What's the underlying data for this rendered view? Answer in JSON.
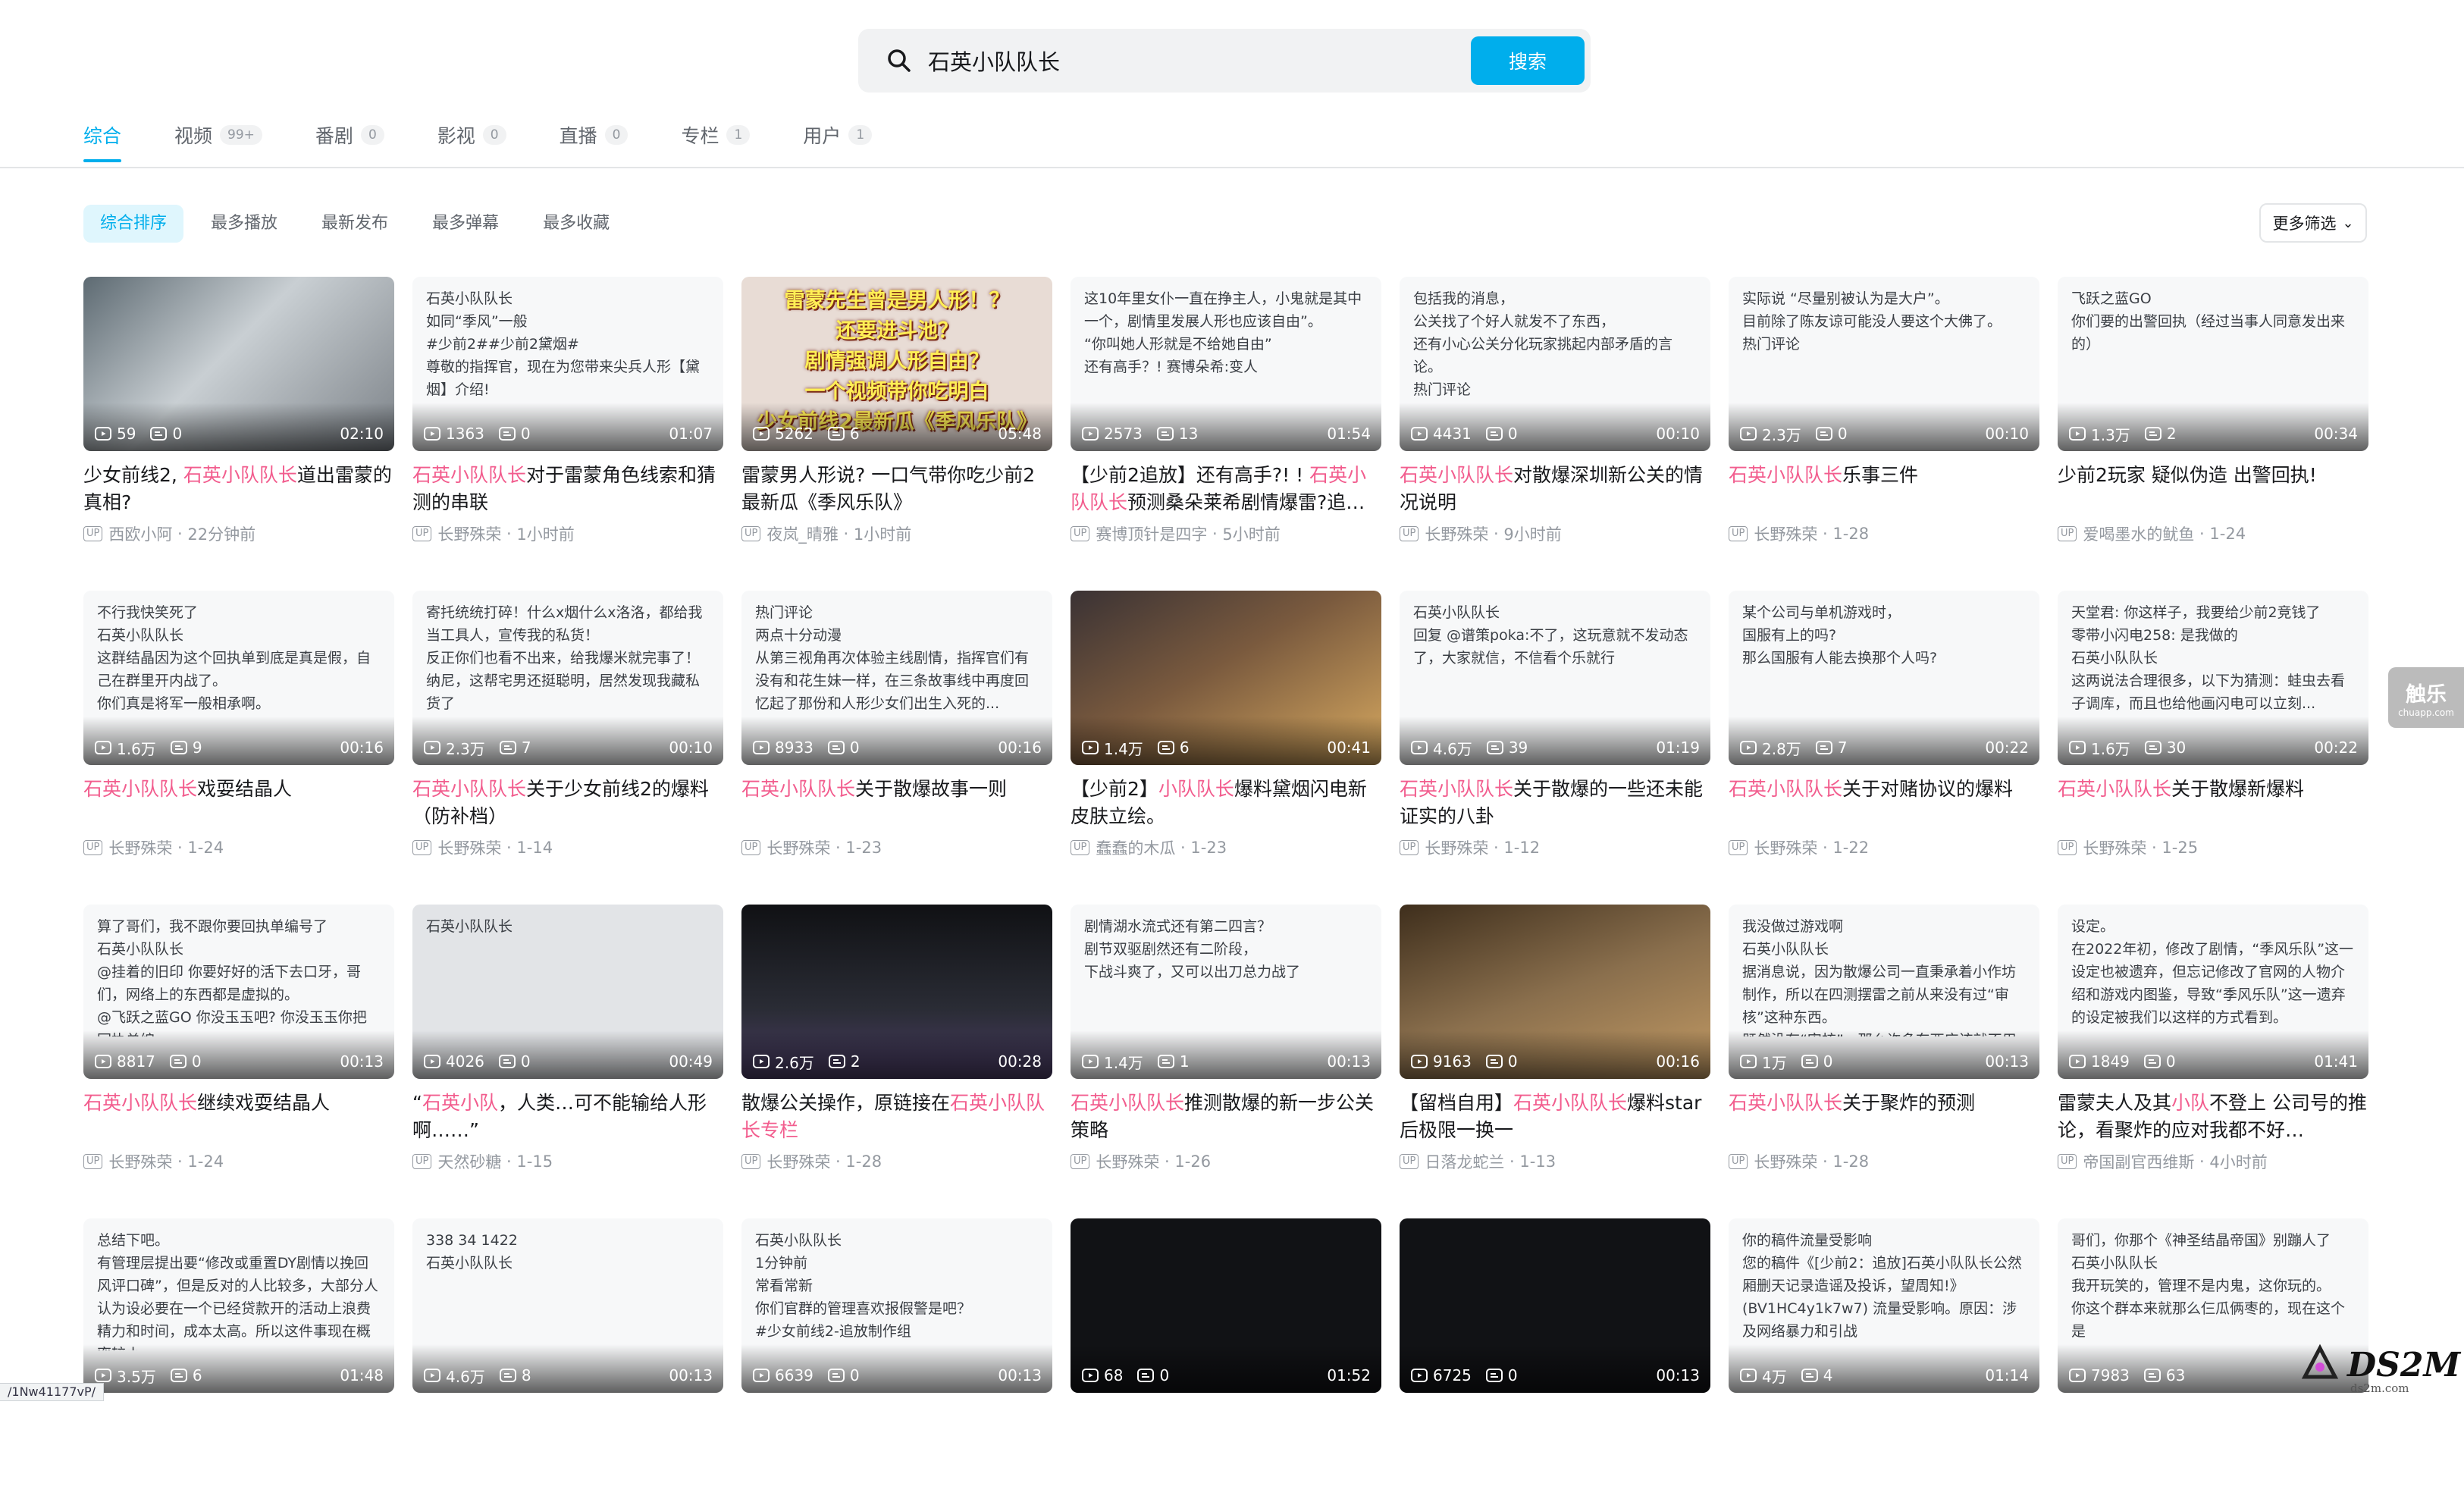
{
  "search": {
    "query": "石英小队队长",
    "button": "搜索"
  },
  "tabs": [
    {
      "label": "综合",
      "count": ""
    },
    {
      "label": "视频",
      "count": "99+"
    },
    {
      "label": "番剧",
      "count": "0"
    },
    {
      "label": "影视",
      "count": "0"
    },
    {
      "label": "直播",
      "count": "0"
    },
    {
      "label": "专栏",
      "count": "1"
    },
    {
      "label": "用户",
      "count": "1"
    }
  ],
  "sorts": [
    "综合排序",
    "最多播放",
    "最新发布",
    "最多弹幕",
    "最多收藏"
  ],
  "filter": {
    "label": "更多筛选"
  },
  "side_widget": {
    "big": "触乐",
    "small": "chuapp.com"
  },
  "brand": {
    "name": "DS2M",
    "sub": "ds2m.com"
  },
  "url_fragment": "/1Nw41177vP/",
  "colors": {
    "accent": "#00aeec",
    "highlight": "#f25d8e",
    "meta": "#9499a0"
  },
  "cards": [
    {
      "thumb": "t-photo1",
      "text": "",
      "banner": "",
      "plays": "59",
      "danmaku": "0",
      "duration": "02:10",
      "title_pre": "少女前线2, ",
      "title_hl": "石英小队队长",
      "title_post": "道出雷蒙的真相?",
      "author": "西欧小阿",
      "date": "22分钟前"
    },
    {
      "thumb": "t-white",
      "text": "石英小队队长\n如同“季风”一般\n#少前2##少前2黛烟#\n尊敬的指挥官，现在为您带来尖兵人形【黛烟】介绍!",
      "banner": "",
      "plays": "1363",
      "danmaku": "0",
      "duration": "01:07",
      "title_pre": "",
      "title_hl": "石英小队队长",
      "title_post": "对于雷蒙角色线索和猜测的串联",
      "author": "长野殊荣",
      "date": "1小时前"
    },
    {
      "thumb": "t-banner",
      "text": "",
      "banner": "雷蒙先生曾是男人形！？\n还要进斗池？\n剧情强调人形自由？\n一个视频带你吃明白\n少女前线2最新瓜《季风乐队》",
      "plays": "5262",
      "danmaku": "6",
      "duration": "05:48",
      "title_pre": "雷蒙男人形说? 一口气带你吃少前2最新瓜《季风乐队》",
      "title_hl": "",
      "title_post": "",
      "author": "夜岚_晴雅",
      "date": "1小时前"
    },
    {
      "thumb": "t-white",
      "text": "这10年里女仆一直在挣主人，小鬼就是其中一个，剧情里发展人形也应该自由”。\n“你叫她人形就是不给她自由”\n还有高手？! 赛博朵希:变人",
      "banner": "",
      "plays": "2573",
      "danmaku": "13",
      "duration": "01:54",
      "title_pre": "【少前2追放】还有高手?! ! ",
      "title_hl": "石英小队队长",
      "title_post": "预测桑朵莱希剧情爆雷?追放…",
      "author": "赛博顶针是四字",
      "date": "5小时前"
    },
    {
      "thumb": "t-white",
      "text": "包括我的消息，\n公关找了个好人就发不了东西，\n还有小心公关分化玩家挑起内部矛盾的言论。\n热门评论",
      "banner": "",
      "plays": "4431",
      "danmaku": "0",
      "duration": "00:10",
      "title_pre": "",
      "title_hl": "石英小队队长",
      "title_post": "对散爆深圳新公关的情况说明",
      "author": "长野殊荣",
      "date": "9小时前"
    },
    {
      "thumb": "t-white",
      "text": "实际说 “尽量别被认为是大户”。\n目前除了陈友谅可能没人要这个大佛了。\n热门评论",
      "banner": "",
      "plays": "2.3万",
      "danmaku": "0",
      "duration": "00:10",
      "title_pre": "",
      "title_hl": "石英小队队长",
      "title_post": "乐事三件",
      "author": "长野殊荣",
      "date": "1-28"
    },
    {
      "thumb": "t-white",
      "text": "飞跃之蓝GO\n你们要的出警回执（经过当事人同意发出来的）",
      "banner": "",
      "plays": "1.3万",
      "danmaku": "2",
      "duration": "00:34",
      "title_pre": "少前2玩家 疑似伪造 出警回执!",
      "title_hl": "",
      "title_post": "",
      "author": "爱喝墨水的鱿鱼",
      "date": "1-24"
    },
    {
      "thumb": "t-white",
      "text": "不行我快笑死了\n石英小队队长\n这群结晶因为这个回执单到底是真是假，自己在群里开内战了。\n你们真是将军一般相承啊。",
      "banner": "",
      "plays": "1.6万",
      "danmaku": "9",
      "duration": "00:16",
      "title_pre": "",
      "title_hl": "石英小队队长",
      "title_post": "戏耍结晶人",
      "author": "长野殊荣",
      "date": "1-24"
    },
    {
      "thumb": "t-white",
      "text": "寄托统统打碎！什么x烟什么x洛洛，都给我当工具人，宣传我的私货！\n反正你们也看不出来，给我爆米就完事了！\n纳尼，这帮宅男还挺聪明，居然发现我藏私货了",
      "banner": "",
      "plays": "2.3万",
      "danmaku": "7",
      "duration": "00:10",
      "title_pre": "",
      "title_hl": "石英小队队长",
      "title_post": "关于少女前线2的爆料（防补档）",
      "author": "长野殊荣",
      "date": "1-14"
    },
    {
      "thumb": "t-white",
      "text": "热门评论\n两点十分动漫\n从第三视角再次体验主线剧情，指挥官们有没有和花生妹一样，在三条故事线中再度回忆起了那份和人形少女们出生入死的...",
      "banner": "",
      "plays": "8933",
      "danmaku": "0",
      "duration": "00:16",
      "title_pre": "",
      "title_hl": "石英小队队长",
      "title_post": "关于散爆故事一则",
      "author": "长野殊荣",
      "date": "1-23"
    },
    {
      "thumb": "t-dark1",
      "text": "",
      "banner": "",
      "plays": "1.4万",
      "danmaku": "6",
      "duration": "00:41",
      "title_pre": "【少前2】",
      "title_hl": "小队队长",
      "title_post": "爆料黛烟闪电新皮肤立绘。",
      "author": "蠢蠢的木瓜",
      "date": "1-23"
    },
    {
      "thumb": "t-white",
      "text": "石英小队队长\n回复 @谱策poka:不了，这玩意就不发动态了，大家就信，不信看个乐就行",
      "banner": "",
      "plays": "4.6万",
      "danmaku": "39",
      "duration": "01:19",
      "title_pre": "",
      "title_hl": "石英小队队长",
      "title_post": "关于散爆的一些还未能证实的八卦",
      "author": "长野殊荣",
      "date": "1-12"
    },
    {
      "thumb": "t-white",
      "text": "某个公司与单机游戏时，\n国服有上的吗?\n那么国服有人能去换那个人吗?",
      "banner": "",
      "plays": "2.8万",
      "danmaku": "7",
      "duration": "00:22",
      "title_pre": "",
      "title_hl": "石英小队队长",
      "title_post": "关于对赌协议的爆料",
      "author": "长野殊荣",
      "date": "1-22"
    },
    {
      "thumb": "t-white",
      "text": "天堂君: 你这样子，我要给少前2竞钱了\n零带小闪电258: 是我做的\n石英小队队长\n这两说法合理很多，以下为猜测：蛙虫去看子调库，而且也给他画闪电可以立刻...",
      "banner": "",
      "plays": "1.6万",
      "danmaku": "30",
      "duration": "00:22",
      "title_pre": "",
      "title_hl": "石英小队队长",
      "title_post": "关于散爆新爆料",
      "author": "长野殊荣",
      "date": "1-25"
    },
    {
      "thumb": "t-white",
      "text": "算了哥们，我不跟你要回执单编号了\n石英小队队长\n@挂着的旧印 你要好好的活下去口牙，哥们，网络上的东西都是虚拟的。\n@飞跃之蓝GO 你没玉玉吧? 你没玉玉你把回执单编",
      "banner": "",
      "plays": "8817",
      "danmaku": "0",
      "duration": "00:13",
      "title_pre": "",
      "title_hl": "石英小队队长",
      "title_post": "继续戏耍结晶人",
      "author": "长野殊荣",
      "date": "1-24"
    },
    {
      "thumb": "t-grey",
      "text": "石英小队队长",
      "banner": "",
      "plays": "4026",
      "danmaku": "0",
      "duration": "00:49",
      "title_pre": "“",
      "title_hl": "石英小队",
      "title_post": "，人类…可不能输给人形啊……”",
      "author": "天然砂糖",
      "date": "1-15"
    },
    {
      "thumb": "t-dark2",
      "text": "",
      "banner": "",
      "plays": "2.6万",
      "danmaku": "2",
      "duration": "00:28",
      "title_pre": "散爆公关操作，原链接在",
      "title_hl": "石英小队队长专栏",
      "title_post": "",
      "author": "长野殊荣",
      "date": "1-28"
    },
    {
      "thumb": "t-white",
      "text": "剧情湖水流式还有第二四言？\n剧节双驱剧然还有二阶段，\n下战斗爽了，又可以出刀总力战了",
      "banner": "",
      "plays": "1.4万",
      "danmaku": "1",
      "duration": "00:13",
      "title_pre": "",
      "title_hl": "石英小队队长",
      "title_post": "推测散爆的新一步公关策略",
      "author": "长野殊荣",
      "date": "1-26"
    },
    {
      "thumb": "t-tv",
      "text": "",
      "banner": "",
      "plays": "9163",
      "danmaku": "0",
      "duration": "00:16",
      "title_pre": "【留档自用】",
      "title_hl": "石英小队队长",
      "title_post": "爆料star后极限一换一",
      "author": "日落龙蛇兰",
      "date": "1-13"
    },
    {
      "thumb": "t-white",
      "text": "我没做过游戏啊\n石英小队队长\n据消息说，因为散爆公司一直秉承着小作坊制作，所以在四测摆雷之前从来没有过“审核”这种东西。\n既然没有“审核”，那么许多东西应该就不用一道一道把关。",
      "banner": "",
      "plays": "1万",
      "danmaku": "0",
      "duration": "00:13",
      "title_pre": "",
      "title_hl": "石英小队队长",
      "title_post": "关于聚炸的预测",
      "author": "长野殊荣",
      "date": "1-28"
    },
    {
      "thumb": "t-white",
      "text": "设定。\n在2022年初，修改了剧情，“季风乐队”这一设定也被遗弃，但忘记修改了官网的人物介绍和游戏内图鉴，导致“季风乐队”这一遗弃的设定被我们以这样的方式看到。",
      "banner": "",
      "plays": "1849",
      "danmaku": "0",
      "duration": "01:41",
      "title_pre": "雷蒙夫人及其",
      "title_hl": "小队",
      "title_post": "不登上 公司号的推论，看聚炸的应对我都不好…",
      "author": "帝国副官西维斯",
      "date": "4小时前"
    },
    {
      "thumb": "t-white",
      "text": "总结下吧。\n有管理层提出要“修改或重置DY剧情以挽回风评口碑”，但是反对的人比较多，大部分人认为设必要在一个已经贷款开的活动上浪费精力和时间，成本太高。所以这件事现在概率较小。",
      "banner": "",
      "plays": "3.5万",
      "danmaku": "6",
      "duration": "01:48",
      "title_pre": "",
      "title_hl": "",
      "title_post": "",
      "author": "",
      "date": ""
    },
    {
      "thumb": "t-white",
      "text": "338 34 1422\n石英小队队长",
      "banner": "",
      "plays": "4.6万",
      "danmaku": "8",
      "duration": "00:13",
      "title_pre": "",
      "title_hl": "",
      "title_post": "",
      "author": "",
      "date": ""
    },
    {
      "thumb": "t-white",
      "text": "石英小队队长\n1分钟前\n常看常新\n你们官群的管理喜欢报假警是吧？\n#少女前线2-追放制作组",
      "banner": "",
      "plays": "6639",
      "danmaku": "0",
      "duration": "00:13",
      "title_pre": "",
      "title_hl": "",
      "title_post": "",
      "author": "",
      "date": ""
    },
    {
      "thumb": "t-black",
      "text": "",
      "banner": "",
      "plays": "68",
      "danmaku": "0",
      "duration": "01:52",
      "title_pre": "",
      "title_hl": "",
      "title_post": "",
      "author": "",
      "date": ""
    },
    {
      "thumb": "t-black",
      "text": "",
      "banner": "",
      "plays": "6725",
      "danmaku": "0",
      "duration": "00:13",
      "title_pre": "",
      "title_hl": "",
      "title_post": "",
      "author": "",
      "date": ""
    },
    {
      "thumb": "t-white",
      "text": "你的稿件流量受影响\n您的稿件《[少前2：追放]石英小队队长公然厢删天记录造谣及投诉，望周知!》(BV1HC4y1k7w7) 流量受影响。原因：涉及网络暴力和引战",
      "banner": "",
      "plays": "4万",
      "danmaku": "4",
      "duration": "01:14",
      "title_pre": "",
      "title_hl": "",
      "title_post": "",
      "author": "",
      "date": ""
    },
    {
      "thumb": "t-white",
      "text": "哥们，你那个《神圣结晶帝国》别蹦人了\n石英小队队长\n我开玩笑的，管理不是内鬼，这你玩的。\n你这个群本来就那么仨瓜俩枣的，现在这个是",
      "banner": "",
      "plays": "7983",
      "danmaku": "63",
      "duration": "",
      "title_pre": "",
      "title_hl": "",
      "title_post": "",
      "author": "",
      "date": ""
    }
  ]
}
